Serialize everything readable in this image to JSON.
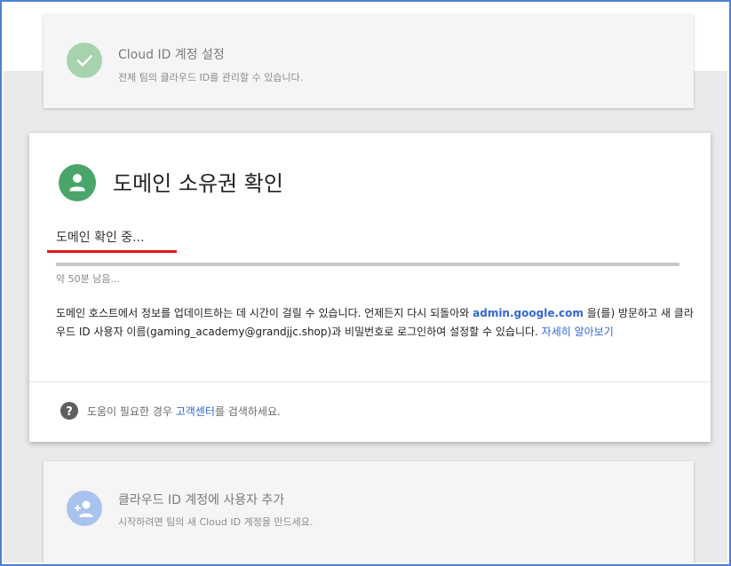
{
  "steps": {
    "previous": {
      "title": "Cloud ID 계정 설정",
      "description": "전체 팀의 클라우드 ID를 관리할 수 있습니다.",
      "icon": "check-icon",
      "color": "#a7d2ae"
    },
    "current": {
      "title": "도메인 소유권 확인",
      "icon": "person-icon",
      "color": "#4aa56a",
      "status": "도메인 확인 중...",
      "progress": 0.0,
      "time_left": "약 50분 남음...",
      "body_part1": "도메인 호스트에서 정보를 업데이트하는 데 시간이 걸릴 수 있습니다. 언제든지 다시 되돌아와 ",
      "body_link_admin": "admin.google.com",
      "body_part2": " 을(를) 방문하고 새 클라우드 ID 사용자 이름(gaming_academy@grandjjc.shop)과 비밀번호로 로그인하여 설정할 수 있습니다. ",
      "body_link_learn": "자세히 알아보기",
      "help_prefix": "도움이 필요한 경우 ",
      "help_link": "고객센터",
      "help_suffix": "를 검색하세요.",
      "help_icon": "help-circle-icon"
    },
    "next": {
      "title": "클라우드 ID 계정에 사용자 추가",
      "description": "시작하려면 팀의 새 Cloud ID 계정을 만드세요.",
      "icon": "add-user-icon",
      "color": "#a9c3ee"
    }
  },
  "colors": {
    "accent_link": "#3367d6",
    "underline_annotation": "#e0141d",
    "frame_border": "#4f7fd1"
  }
}
